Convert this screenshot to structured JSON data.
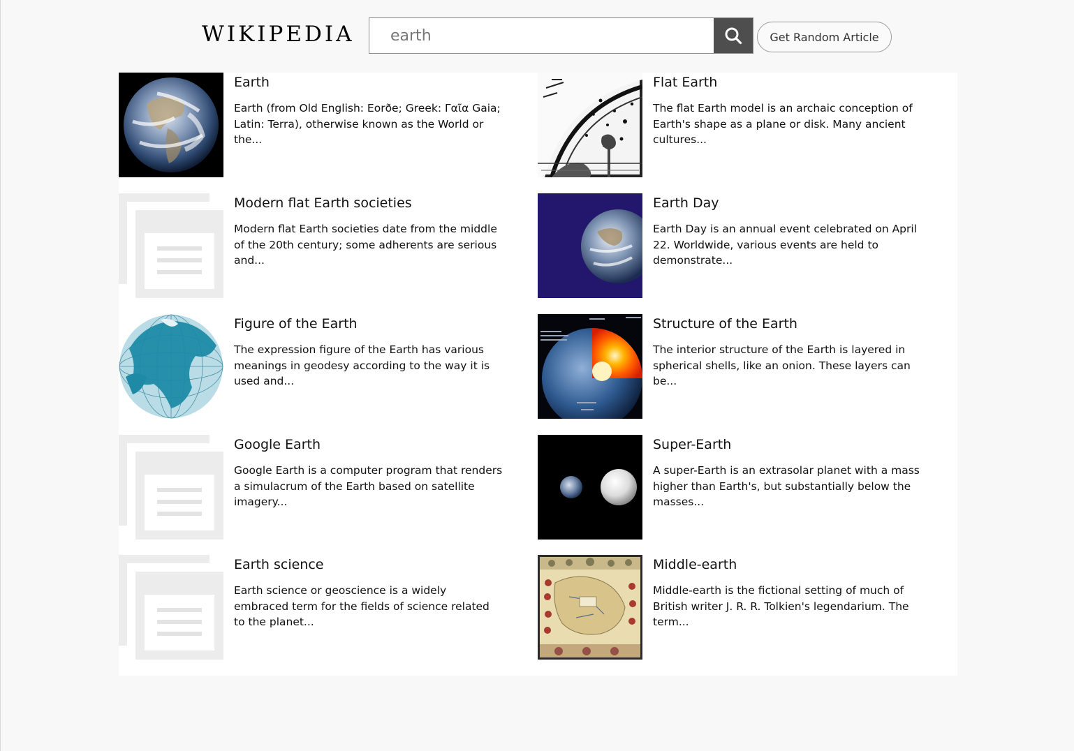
{
  "header": {
    "logo": "WIKIPEDIA",
    "search_value": "earth",
    "random_label": "Get Random Article"
  },
  "results": [
    {
      "title": "Earth",
      "extract": "Earth (from Old English: Eorðe; Greek: Γαῖα Gaia; Latin: Terra), otherwise known as the World or the...",
      "thumb": "earth-globe-photo"
    },
    {
      "title": "Flat Earth",
      "extract": "The flat Earth model is an archaic conception of Earth's shape as a plane or disk. Many ancient cultures...",
      "thumb": "flammarion-engraving"
    },
    {
      "title": "Modern flat Earth societies",
      "extract": "Modern flat Earth societies date from the middle of the 20th century; some adherents are serious and...",
      "thumb": "placeholder-article-icon"
    },
    {
      "title": "Earth Day",
      "extract": "Earth Day is an annual event celebrated on April 22. Worldwide, various events are held to demonstrate...",
      "thumb": "earth-day-flag"
    },
    {
      "title": "Figure of the Earth",
      "extract": "The expression figure of the Earth has various meanings in geodesy according to the way it is used and...",
      "thumb": "blue-globe-map"
    },
    {
      "title": "Structure of the Earth",
      "extract": "The interior structure of the Earth is layered in spherical shells, like an onion. These layers can be...",
      "thumb": "earth-cutaway-diagram"
    },
    {
      "title": "Google Earth",
      "extract": "Google Earth is a computer program that renders a simulacrum of the Earth based on satellite imagery...",
      "thumb": "placeholder-article-icon"
    },
    {
      "title": "Super-Earth",
      "extract": "A super-Earth is an extrasolar planet with a mass higher than Earth's, but substantially below the masses...",
      "thumb": "super-earth-comparison"
    },
    {
      "title": "Earth science",
      "extract": "Earth science or geoscience is a widely embraced term for the fields of science related to the planet...",
      "thumb": "placeholder-article-icon"
    },
    {
      "title": "Middle-earth",
      "extract": "Middle-earth is the fictional setting of much of British writer J. R. R. Tolkien's legendarium. The term...",
      "thumb": "middle-earth-map"
    }
  ],
  "colors": {
    "search_button": "#4e4e4e",
    "page_background": "#f8f8f8",
    "panel_background": "#ffffff",
    "earth_day_blue": "#23166d"
  }
}
